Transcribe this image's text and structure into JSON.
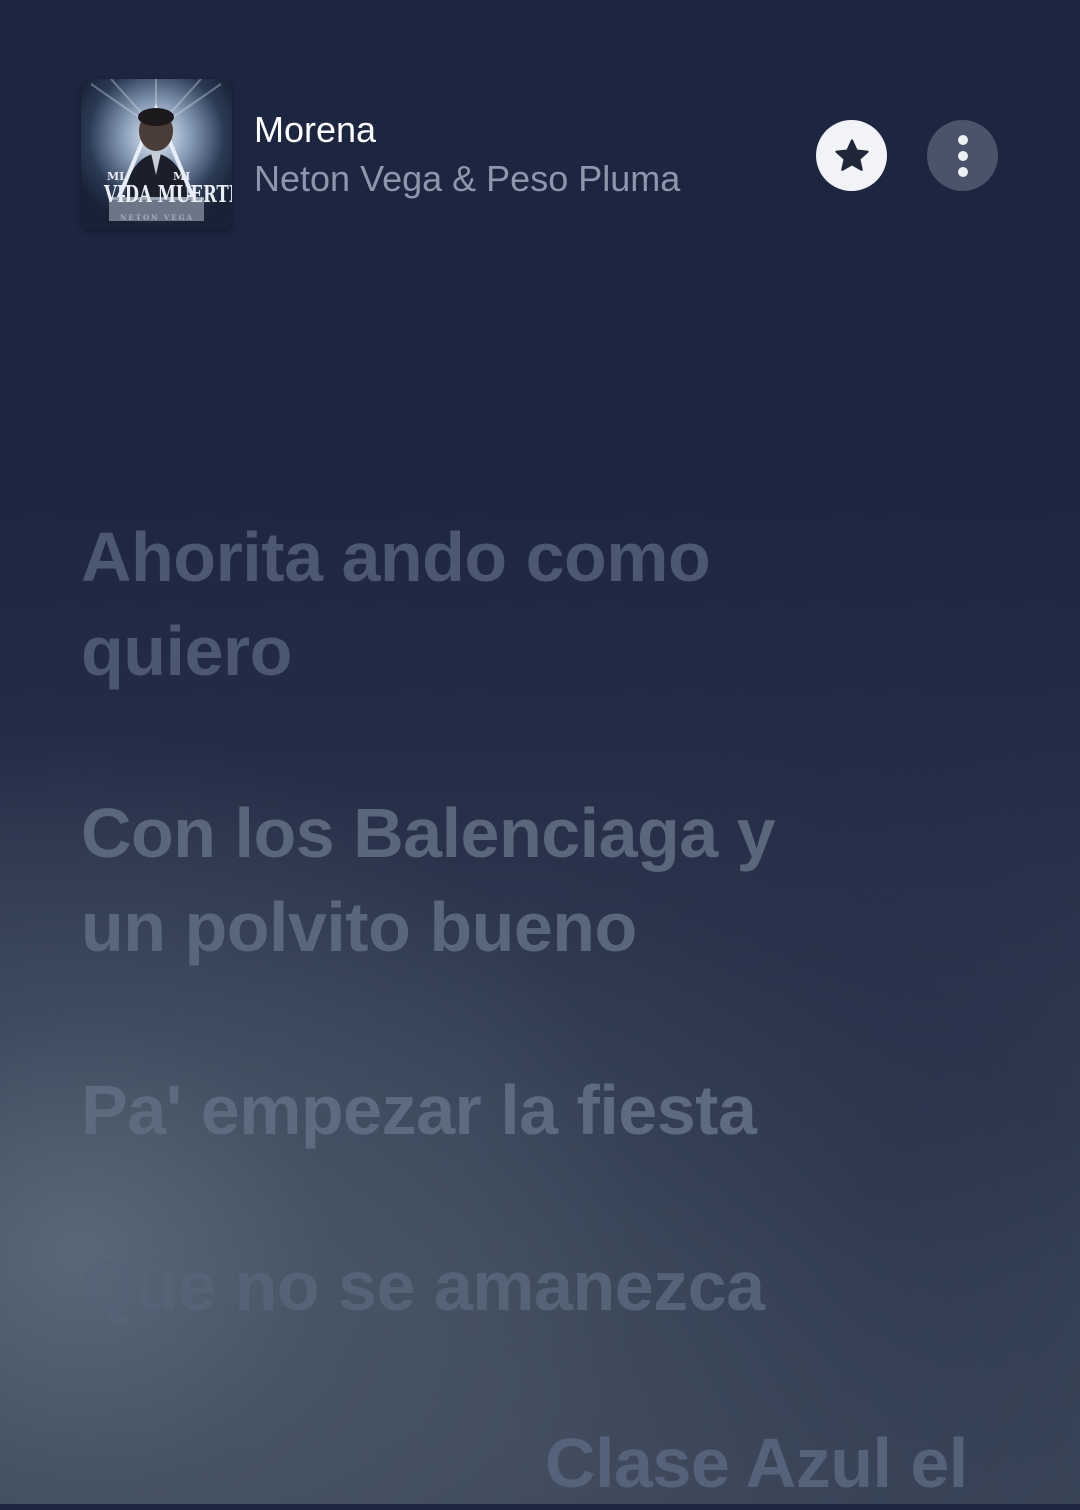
{
  "now_playing": {
    "title": "Morena",
    "artist": "Neton Vega & Peso Pluma",
    "album_art": {
      "text_left": "MI",
      "text_right": "MI",
      "text_main": "VIDA MUERTE",
      "text_bottom": "NETON VEGA"
    }
  },
  "actions": {
    "favorite_icon": "star-icon",
    "more_icon": "more-vertical-icon"
  },
  "lyrics": [
    "Ahorita ando como quiero",
    "Con los Balenciaga y un polvito bueno",
    "Pa' empezar la fiesta",
    "Que no se amanezca",
    "Clase Azul el"
  ],
  "colors": {
    "background_top": "#1d2640",
    "background_bottom": "#3a4658",
    "title": "#ffffff",
    "artist": "#8d97ab",
    "lyric_inactive": "#56627a",
    "star_button_bg": "#f2f3f6",
    "more_button_bg": "#4a5369"
  }
}
